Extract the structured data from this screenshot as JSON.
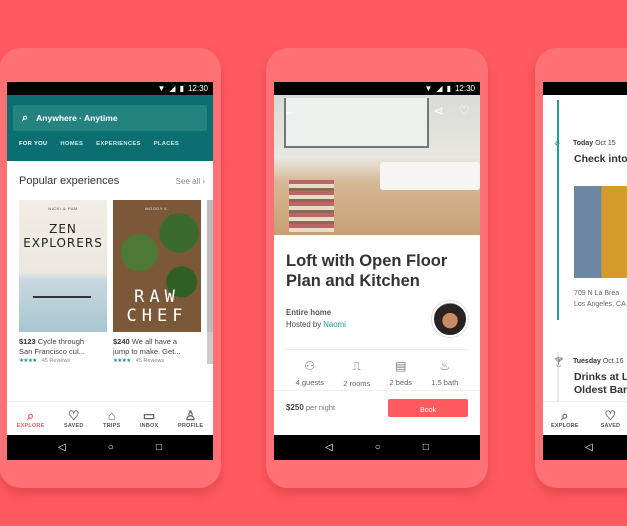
{
  "status_bar": {
    "time": "12:30"
  },
  "system_nav": {
    "back": "◁",
    "home": "○",
    "recents": "□"
  },
  "colors": {
    "background": "#ff5a5f",
    "phone_body": "#ff7175",
    "teal_header": "#0b6f72",
    "accent": "#ff5a5f",
    "link": "#19a69b",
    "rating": "#1b8a7f"
  },
  "explore": {
    "search": {
      "placeholder": "Anywhere · Anytime",
      "icon": "search-icon"
    },
    "top_tabs": [
      "FOR YOU",
      "HOMES",
      "EXPERIENCES",
      "PLACES"
    ],
    "active_top_tab": "FOR YOU",
    "section": {
      "title": "Popular experiences",
      "see_all": "See all ›"
    },
    "cards": [
      {
        "cover_title": "ZEN EXPLORERS",
        "cover_subtitle": "NICKI & PAM",
        "price": "$123",
        "desc_line1": "Cycle through",
        "desc_line2": "San Francisco cul...",
        "stars": "★★★★",
        "rating": 4,
        "reviews": "45 Reviews"
      },
      {
        "cover_title": "RAW CHEF",
        "cover_subtitle": "WOODY K.",
        "price": "$240",
        "desc_line1": "We all have a",
        "desc_line2": "jump to make. Get...",
        "stars": "★★★★",
        "rating": 4,
        "reviews": "45 Reviews"
      }
    ],
    "bottom_tabs": [
      {
        "label": "EXPLORE",
        "icon": "search-icon",
        "glyph": "⌕"
      },
      {
        "label": "SAVED",
        "icon": "heart-icon",
        "glyph": "♡"
      },
      {
        "label": "TRIPS",
        "icon": "airbnb-logo-icon",
        "glyph": "⌂"
      },
      {
        "label": "INBOX",
        "icon": "message-icon",
        "glyph": "▭"
      },
      {
        "label": "PROFILE",
        "icon": "user-icon",
        "glyph": "♙"
      }
    ]
  },
  "listing": {
    "title": "Loft with Open Floor Plan and Kitchen",
    "type": "Entire home",
    "hosted_by": "Hosted by",
    "host": "Naomi",
    "amenities": [
      {
        "label": "4 guests",
        "icon": "guests-icon",
        "glyph": "⚇"
      },
      {
        "label": "2 rooms",
        "icon": "door-icon",
        "glyph": "⎍"
      },
      {
        "label": "2 beds",
        "icon": "bed-icon",
        "glyph": "▤"
      },
      {
        "label": "1.5 bath",
        "icon": "bath-icon",
        "glyph": "♨"
      }
    ],
    "price": "$250",
    "per_night": "per night",
    "book_label": "Book"
  },
  "trips": {
    "events": [
      {
        "day": "Today",
        "date": "Oct 15",
        "title": "Check into",
        "address_line1": "709 N La Brea",
        "address_line2": "Los Angeles, CA"
      },
      {
        "day": "Tuesday",
        "date": "Oct 16",
        "title_line1": "Drinks at L",
        "title_line2": "Oldest Bar"
      }
    ],
    "bottom_tabs": [
      {
        "label": "EXPLORE",
        "glyph": "⌕"
      },
      {
        "label": "SAVED",
        "glyph": "♡"
      }
    ]
  }
}
